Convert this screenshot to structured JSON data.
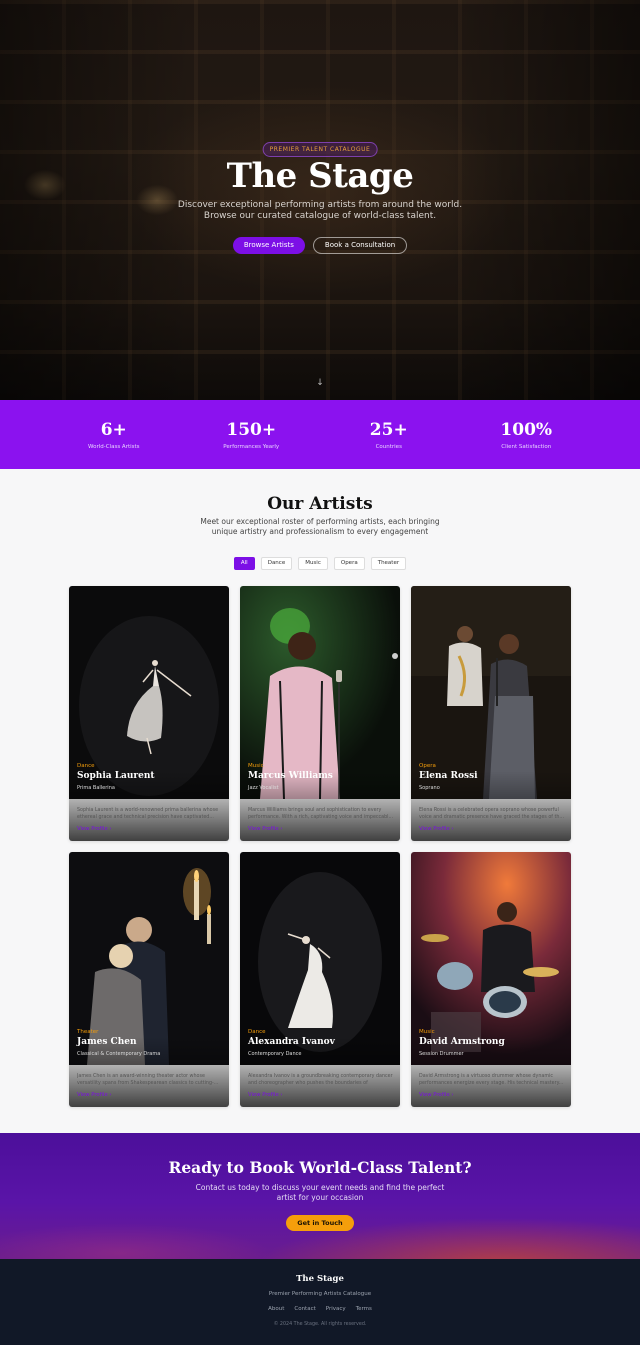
{
  "hero": {
    "badge": "PREMIER TALENT CATALOGUE",
    "title": "The Stage",
    "subtitle_line1": "Discover exceptional performing artists from around the world.",
    "subtitle_line2": "Browse our curated catalogue of world-class talent.",
    "primary_button": "Browse Artists",
    "secondary_button": "Book a Consultation",
    "scroll_icon": "arrow-down-icon"
  },
  "stats": [
    {
      "value": "6+",
      "label": "World-Class Artists"
    },
    {
      "value": "150+",
      "label": "Performances Yearly"
    },
    {
      "value": "25+",
      "label": "Countries"
    },
    {
      "value": "100%",
      "label": "Client Satisfaction"
    }
  ],
  "artists_section": {
    "title": "Our Artists",
    "subtitle_line1": "Meet our exceptional roster of performing artists, each bringing",
    "subtitle_line2": "unique artistry and professionalism to every engagement",
    "filters": [
      "All",
      "Dance",
      "Music",
      "Opera",
      "Theater"
    ],
    "active_filter": "All",
    "view_profile_label": "View Profile",
    "cards": [
      {
        "category": "Dance",
        "name": "Sophia Laurent",
        "role": "Prima Ballerina",
        "description": "Sophia Laurent is a world-renowned prima ballerina whose ethereal grace and technical precision have captivated..."
      },
      {
        "category": "Music",
        "name": "Marcus Williams",
        "role": "Jazz Vocalist",
        "description": "Marcus Williams brings soul and sophistication to every performance. With a rich, captivating voice and impeccabl..."
      },
      {
        "category": "Opera",
        "name": "Elena Rossi",
        "role": "Soprano",
        "description": "Elena Rossi is a celebrated opera soprano whose powerful voice and dramatic presence have graced the stages of th..."
      },
      {
        "category": "Theater",
        "name": "James Chen",
        "role": "Classical & Contemporary Drama",
        "description": "James Chen is an award-winning theater actor whose versatility spans from Shakespearean classics to cutting-..."
      },
      {
        "category": "Dance",
        "name": "Alexandra Ivanov",
        "role": "Contemporary Dance",
        "description": "Alexandra Ivanov is a groundbreaking contemporary dancer and choreographer who pushes the boundaries of moveme..."
      },
      {
        "category": "Music",
        "name": "David Armstrong",
        "role": "Session Drummer",
        "description": "David Armstrong is a virtuoso drummer whose dynamic performances energize every stage. His technical mastery..."
      }
    ]
  },
  "cta": {
    "title": "Ready to Book World-Class Talent?",
    "subtitle_line1": "Contact us today to discuss your event needs and find the perfect",
    "subtitle_line2": "artist for your occasion",
    "button": "Get in Touch"
  },
  "footer": {
    "brand": "The Stage",
    "tagline": "Premier Performing Artists Catalogue",
    "links": [
      "About",
      "Contact",
      "Privacy",
      "Terms"
    ],
    "copyright": "© 2024 The Stage. All rights reserved."
  },
  "colors": {
    "accent": "#7c0fe6",
    "stats_band": "#8b12ef",
    "category": "#f59e0b",
    "cta_button": "#f59e0b",
    "footer_bg": "#111827"
  }
}
